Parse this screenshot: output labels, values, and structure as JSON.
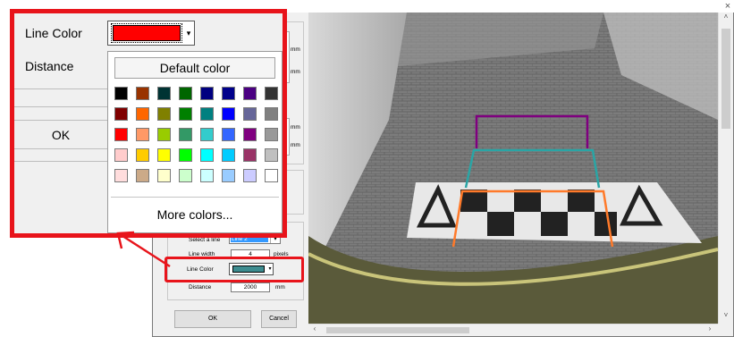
{
  "dialog": {
    "title": "",
    "close": "×",
    "unit_mm": "mm",
    "select_line_label": "Select a line",
    "select_line_value": "Line 2",
    "line_width_label": "Line width",
    "line_width_value": "4",
    "line_width_unit": "pixels",
    "line_color_label": "Line Color",
    "line_color_value": "#3d8c8f",
    "distance_label": "Distance",
    "distance_value": "2000",
    "distance_unit": "mm",
    "ok_label": "OK",
    "cancel_label": "Cancel"
  },
  "scroll": {
    "up": "˄",
    "down": "˅",
    "left": "‹",
    "right": "›"
  },
  "popup": {
    "line_color_label": "Line Color",
    "distance_label": "Distance",
    "ok_label": "OK",
    "selected_color": "#ff0000",
    "dropdown_arrow": "▾",
    "default_color_label": "Default color",
    "more_colors_label": "More colors...",
    "swatches": [
      [
        "#000000",
        "#993300",
        "#003333",
        "#006600",
        "#000080",
        "#00008b",
        "#4b0082",
        "#333333"
      ],
      [
        "#800000",
        "#ff6600",
        "#808000",
        "#008000",
        "#008080",
        "#0000ff",
        "#666699",
        "#808080"
      ],
      [
        "#ff0000",
        "#ff9966",
        "#99cc00",
        "#339966",
        "#33cccc",
        "#3366ff",
        "#800080",
        "#999999"
      ],
      [
        "#ffcccc",
        "#ffcc00",
        "#ffff00",
        "#00ff00",
        "#00ffff",
        "#00ccff",
        "#993366",
        "#c0c0c0"
      ],
      [
        "#ffdddd",
        "#ccaa88",
        "#ffffcc",
        "#ccffcc",
        "#ccffff",
        "#99ccff",
        "#ccccff",
        "#ffffff"
      ]
    ]
  },
  "overlay_lines": {
    "purple": "#800080",
    "teal": "#2aa5a5",
    "orange": "#ff7a2a"
  },
  "highlight_color": "#e8141b"
}
